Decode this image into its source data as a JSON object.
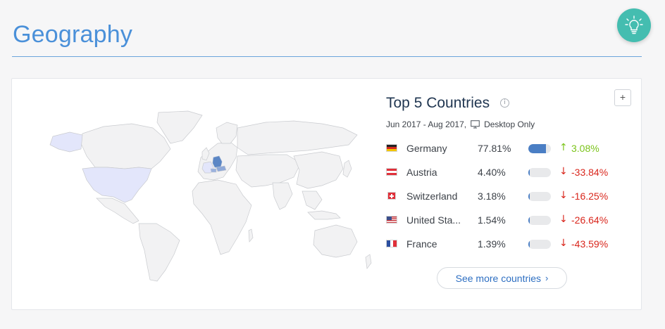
{
  "page": {
    "title": "Geography"
  },
  "panel": {
    "title": "Top 5 Countries",
    "info_glyph": "i",
    "expand_glyph": "+",
    "date_range": "Jun 2017 - Aug 2017,",
    "device_filter": "Desktop Only",
    "see_more_label": "See more countries",
    "see_more_chevron": "›"
  },
  "countries": [
    {
      "name": "Germany",
      "share": "77.81%",
      "share_value": 77.81,
      "change": "3.08%",
      "direction": "up",
      "arrow": "↑"
    },
    {
      "name": "Austria",
      "share": "4.40%",
      "share_value": 4.4,
      "change": "-33.84%",
      "direction": "down",
      "arrow": "↓"
    },
    {
      "name": "Switzerland",
      "share": "3.18%",
      "share_value": 3.18,
      "change": "-16.25%",
      "direction": "down",
      "arrow": "↓"
    },
    {
      "name": "United Sta...",
      "share": "1.54%",
      "share_value": 1.54,
      "change": "-26.64%",
      "direction": "down",
      "arrow": "↓"
    },
    {
      "name": "France",
      "share": "1.39%",
      "share_value": 1.39,
      "change": "-43.59%",
      "direction": "down",
      "arrow": "↓"
    }
  ],
  "colors": {
    "accent": "#4a90d9",
    "bar": "#4a7ec4",
    "positive": "#7bc41a",
    "negative": "#d9261c",
    "insight_button": "#44bdb0",
    "map_highlight_strong": "#5b86c5",
    "map_highlight_light": "#e3e6fb"
  },
  "icons": {
    "insight": "lightbulb-icon",
    "info": "info-icon",
    "expand": "plus-icon",
    "device": "monitor-icon"
  }
}
